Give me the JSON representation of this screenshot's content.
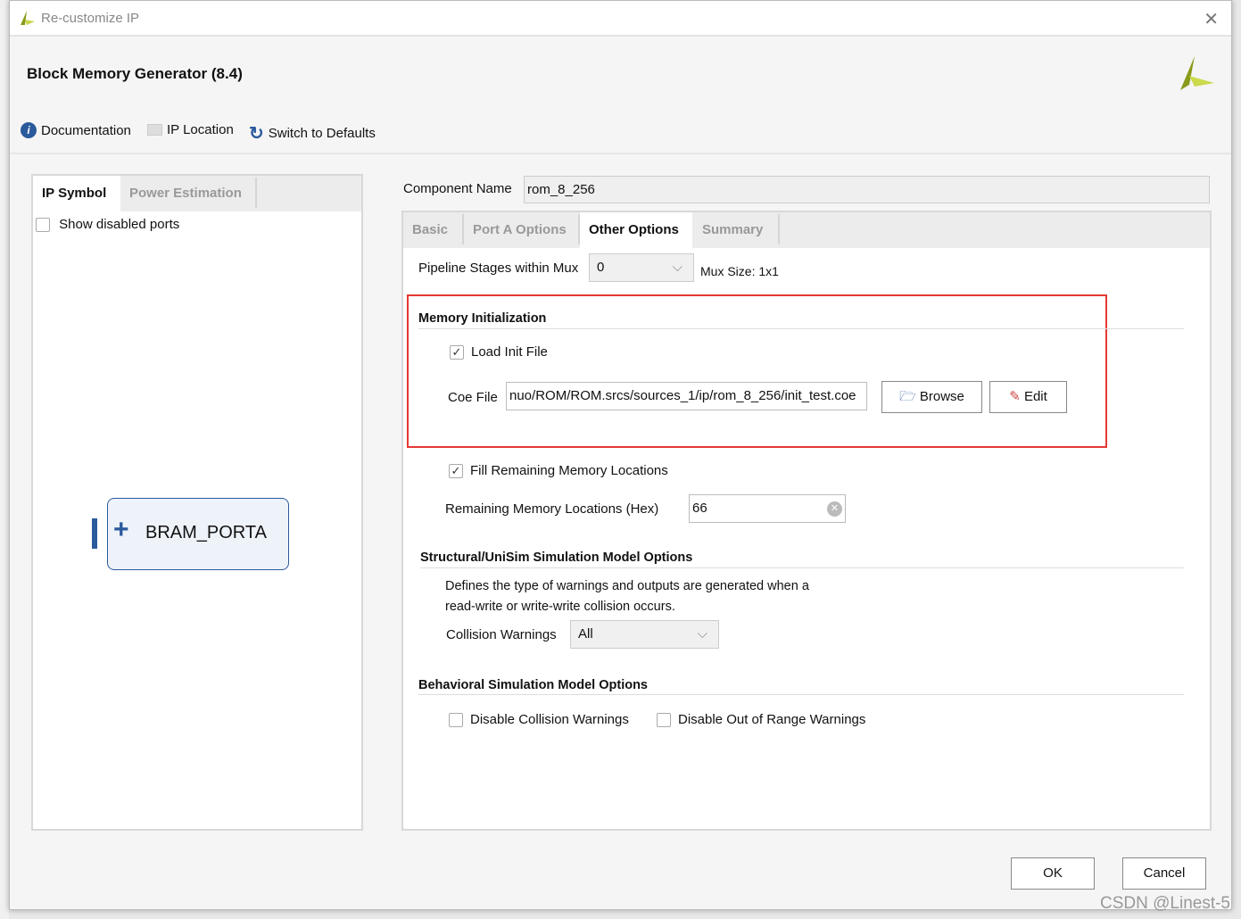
{
  "window": {
    "title": "Re-customize IP",
    "close_icon": "close-icon"
  },
  "header": {
    "title": "Block Memory Generator (8.4)"
  },
  "toolbar": {
    "documentation": "Documentation",
    "ip_location": "IP Location",
    "switch_defaults": "Switch to Defaults"
  },
  "left_panel": {
    "tabs": [
      "IP Symbol",
      "Power Estimation"
    ],
    "show_disabled_ports": "Show disabled ports",
    "show_disabled_checked": false,
    "port_label": "BRAM_PORTA"
  },
  "component": {
    "label": "Component Name",
    "value": "rom_8_256"
  },
  "tabs": [
    "Basic",
    "Port A Options",
    "Other Options",
    "Summary"
  ],
  "active_tab": "Other Options",
  "other_options": {
    "pipeline_label": "Pipeline Stages within Mux",
    "pipeline_value": "0",
    "mux_size": "Mux Size: 1x1",
    "mem_init": {
      "title": "Memory Initialization",
      "load_init_label": "Load Init File",
      "load_init_checked": true,
      "coe_label": "Coe File",
      "coe_value": "nuo/ROM/ROM.srcs/sources_1/ip/rom_8_256/init_test.coe",
      "browse": "Browse",
      "edit": "Edit",
      "highlight_color": "#e53935"
    },
    "fill_label": "Fill Remaining Memory Locations",
    "fill_checked": true,
    "remaining_label": "Remaining Memory Locations (Hex)",
    "remaining_value": "66",
    "structural": {
      "title": "Structural/UniSim Simulation Model Options",
      "desc1": "Defines the type of warnings and outputs are generated when a",
      "desc2": "read-write or write-write collision occurs.",
      "collision_label": "Collision Warnings",
      "collision_value": "All"
    },
    "behavioral": {
      "title": "Behavioral Simulation Model Options",
      "disable_collision": "Disable Collision Warnings",
      "disable_range": "Disable Out of Range Warnings"
    }
  },
  "footer": {
    "ok": "OK",
    "cancel": "Cancel",
    "watermark": "CSDN @Linest-5"
  }
}
